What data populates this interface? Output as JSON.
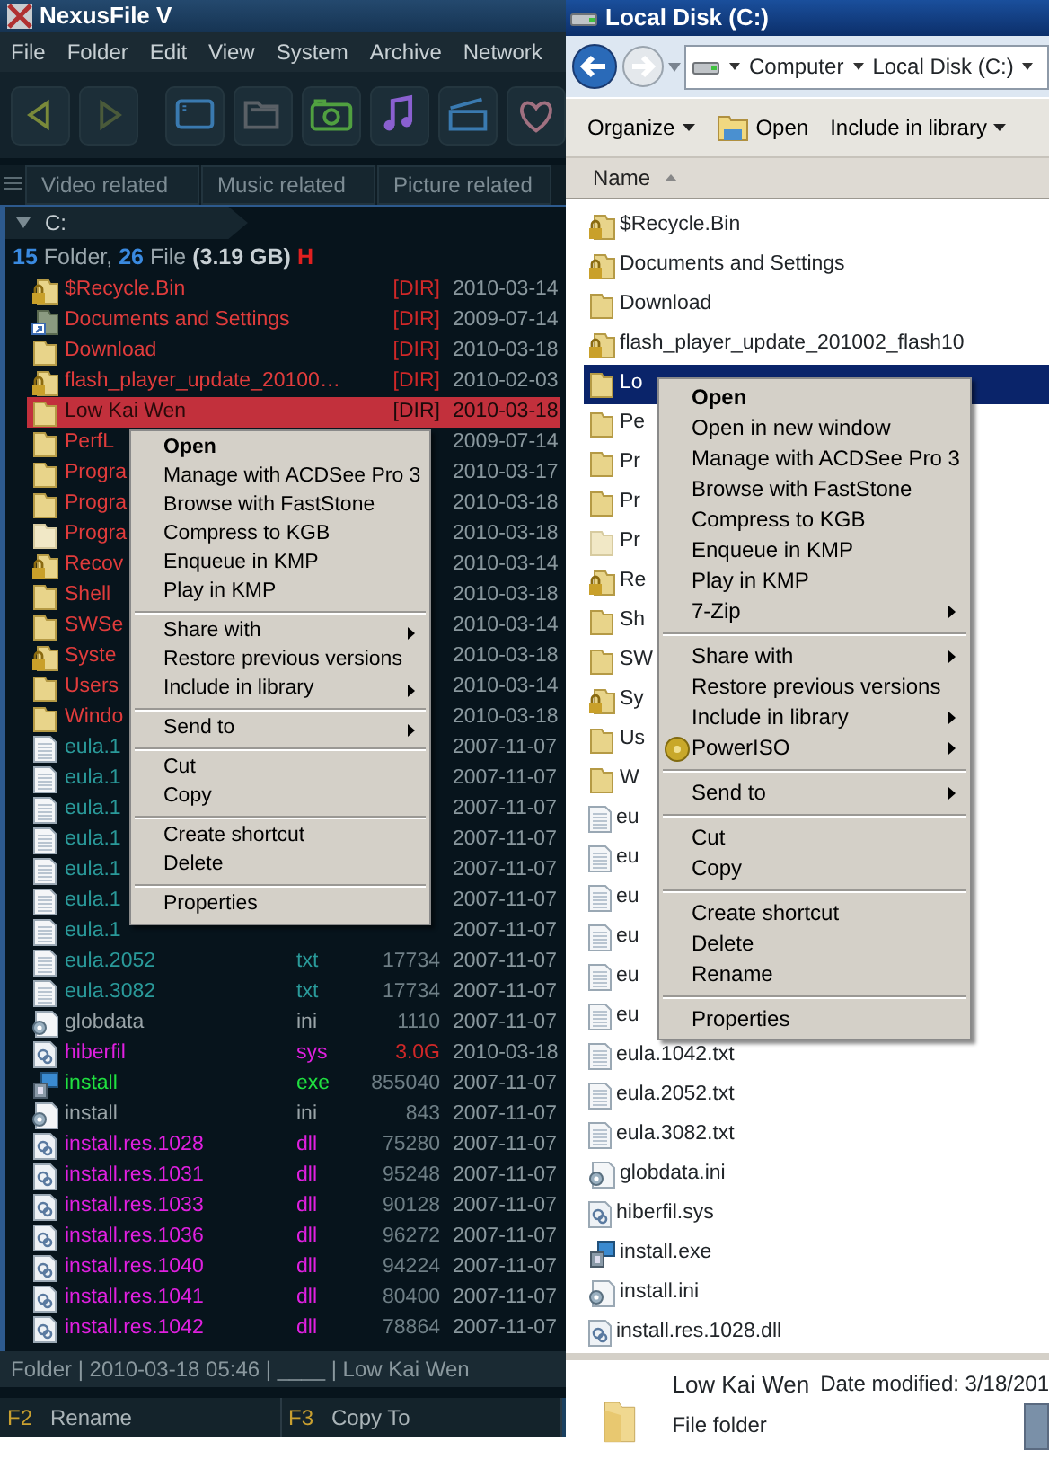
{
  "nexusfile": {
    "title": "NexusFile V",
    "menu": [
      "File",
      "Folder",
      "Edit",
      "View",
      "System",
      "Archive",
      "Network"
    ],
    "tabs": [
      "Video related",
      "Music related",
      "Picture related"
    ],
    "path": "C:",
    "summary": [
      {
        "text": "15",
        "kind": "count"
      },
      {
        "text": " Folder, ",
        "kind": "plain"
      },
      {
        "text": "26",
        "kind": "count"
      },
      {
        "text": " File ",
        "kind": "plain"
      },
      {
        "text": "(3.19 GB)",
        "kind": "size"
      },
      {
        "text": " H",
        "kind": "flag"
      }
    ],
    "rows": [
      {
        "kind": "locked-folder",
        "name": "$Recycle.Bin",
        "size": "[DIR]",
        "size_alert": true,
        "date": "2010-03-14",
        "color": "#e03c3c",
        "selected": false
      },
      {
        "kind": "shortcut-folder",
        "name": "Documents and Settings",
        "size": "[DIR]",
        "size_alert": true,
        "date": "2009-07-14",
        "color": "#e03c3c",
        "selected": false
      },
      {
        "kind": "folder",
        "name": "Download",
        "size": "[DIR]",
        "size_alert": true,
        "date": "2010-03-18",
        "color": "#e03c3c",
        "selected": false
      },
      {
        "kind": "locked-folder",
        "name": "flash_player_update_20100…",
        "size": "[DIR]",
        "size_alert": true,
        "date": "2010-02-03",
        "color": "#e03c3c",
        "selected": false
      },
      {
        "kind": "folder",
        "name": "Low Kai Wen",
        "size": "[DIR]",
        "size_alert": true,
        "date": "2010-03-18",
        "color": "#2a0a0a",
        "selected": true
      },
      {
        "kind": "folder",
        "name": "PerfL",
        "date": "2009-07-14",
        "color": "#e03c3c",
        "selected": false
      },
      {
        "kind": "folder",
        "name": "Progra",
        "date": "2010-03-17",
        "color": "#e03c3c",
        "selected": false
      },
      {
        "kind": "folder",
        "name": "Progra",
        "date": "2010-03-18",
        "color": "#e03c3c",
        "selected": false
      },
      {
        "kind": "dim-folder",
        "name": "Progra",
        "date": "2010-03-18",
        "color": "#e03c3c",
        "selected": false
      },
      {
        "kind": "locked-folder",
        "name": "Recov",
        "date": "2010-03-14",
        "color": "#e03c3c",
        "selected": false
      },
      {
        "kind": "folder",
        "name": "Shell",
        "date": "2010-03-18",
        "color": "#e03c3c",
        "selected": false
      },
      {
        "kind": "folder",
        "name": "SWSe",
        "date": "2010-03-14",
        "color": "#e03c3c",
        "selected": false
      },
      {
        "kind": "locked-folder",
        "name": "Syste",
        "date": "2010-03-18",
        "color": "#e03c3c",
        "selected": false
      },
      {
        "kind": "folder",
        "name": "Users",
        "date": "2010-03-14",
        "color": "#e03c3c",
        "selected": false
      },
      {
        "kind": "folder",
        "name": "Windo",
        "date": "2010-03-18",
        "color": "#e03c3c",
        "selected": false
      },
      {
        "kind": "text",
        "name": "eula.1",
        "date": "2007-11-07",
        "color": "#2a9a9a",
        "selected": false
      },
      {
        "kind": "text",
        "name": "eula.1",
        "date": "2007-11-07",
        "color": "#2a9a9a",
        "selected": false
      },
      {
        "kind": "text",
        "name": "eula.1",
        "date": "2007-11-07",
        "color": "#2a9a9a",
        "selected": false
      },
      {
        "kind": "text",
        "name": "eula.1",
        "date": "2007-11-07",
        "color": "#2a9a9a",
        "selected": false
      },
      {
        "kind": "text",
        "name": "eula.1",
        "date": "2007-11-07",
        "color": "#2a9a9a",
        "selected": false
      },
      {
        "kind": "text",
        "name": "eula.1",
        "date": "2007-11-07",
        "color": "#2a9a9a",
        "selected": false
      },
      {
        "kind": "text",
        "name": "eula.1",
        "date": "2007-11-07",
        "color": "#2a9a9a",
        "selected": false
      },
      {
        "kind": "text",
        "name": "eula.2052",
        "ext": "txt",
        "size": "17734",
        "date": "2007-11-07",
        "color": "#2a9a9a",
        "selected": false
      },
      {
        "kind": "text",
        "name": "eula.3082",
        "ext": "txt",
        "size": "17734",
        "date": "2007-11-07",
        "color": "#2a9a9a",
        "selected": false
      },
      {
        "kind": "settings",
        "name": "globdata",
        "ext": "ini",
        "size": "1110",
        "date": "2007-11-07",
        "color": "#9aa4a8",
        "selected": false
      },
      {
        "kind": "system",
        "name": "hiberfil",
        "ext": "sys",
        "size": "3.0G",
        "size_alert": true,
        "date": "2010-03-18",
        "color": "#e020e0",
        "selected": false
      },
      {
        "kind": "installer",
        "name": "install",
        "ext": "exe",
        "size": "855040",
        "date": "2007-11-07",
        "color": "#20e040",
        "selected": false
      },
      {
        "kind": "settings",
        "name": "install",
        "ext": "ini",
        "size": "843",
        "date": "2007-11-07",
        "color": "#9aa4a8",
        "selected": false
      },
      {
        "kind": "system",
        "name": "install.res.1028",
        "ext": "dll",
        "size": "75280",
        "date": "2007-11-07",
        "color": "#e020e0",
        "selected": false
      },
      {
        "kind": "system",
        "name": "install.res.1031",
        "ext": "dll",
        "size": "95248",
        "date": "2007-11-07",
        "color": "#e020e0",
        "selected": false
      },
      {
        "kind": "system",
        "name": "install.res.1033",
        "ext": "dll",
        "size": "90128",
        "date": "2007-11-07",
        "color": "#e020e0",
        "selected": false
      },
      {
        "kind": "system",
        "name": "install.res.1036",
        "ext": "dll",
        "size": "96272",
        "date": "2007-11-07",
        "color": "#e020e0",
        "selected": false
      },
      {
        "kind": "system",
        "name": "install.res.1040",
        "ext": "dll",
        "size": "94224",
        "date": "2007-11-07",
        "color": "#e020e0",
        "selected": false
      },
      {
        "kind": "system",
        "name": "install.res.1041",
        "ext": "dll",
        "size": "80400",
        "date": "2007-11-07",
        "color": "#e020e0",
        "selected": false
      },
      {
        "kind": "system",
        "name": "install.res.1042",
        "ext": "dll",
        "size": "78864",
        "date": "2007-11-07",
        "color": "#e020e0",
        "selected": false
      }
    ],
    "context_menu": [
      [
        {
          "label": "Open",
          "default": true
        },
        {
          "label": "Manage with ACDSee Pro 3"
        },
        {
          "label": "Browse with FastStone"
        },
        {
          "label": "Compress to KGB"
        },
        {
          "label": "Enqueue in KMP"
        },
        {
          "label": "Play in KMP"
        }
      ],
      [
        {
          "label": "Share with",
          "submenu": true
        },
        {
          "label": "Restore previous versions"
        },
        {
          "label": "Include in library",
          "submenu": true
        }
      ],
      [
        {
          "label": "Send to",
          "submenu": true
        }
      ],
      [
        {
          "label": "Cut"
        },
        {
          "label": "Copy"
        }
      ],
      [
        {
          "label": "Create shortcut"
        },
        {
          "label": "Delete"
        }
      ],
      [
        {
          "label": "Properties"
        }
      ]
    ],
    "status": "Folder | 2010-03-18 05:46 | ____ | Low Kai Wen",
    "function_keys": [
      {
        "key": "F2",
        "label": "Rename"
      },
      {
        "key": "F3",
        "label": "Copy To"
      }
    ]
  },
  "explorer": {
    "title": "Local Disk (C:)",
    "breadcrumb": [
      "Computer",
      "Local Disk (C:)"
    ],
    "commands": [
      {
        "label": "Organize",
        "kind": "menu"
      },
      {
        "label": "Open",
        "kind": "action"
      },
      {
        "label": "Include in library",
        "kind": "menu"
      }
    ],
    "column": "Name",
    "rows": [
      {
        "kind": "locked-folder",
        "name": "$Recycle.Bin",
        "selected": false
      },
      {
        "kind": "locked-folder",
        "name": "Documents and Settings",
        "selected": false
      },
      {
        "kind": "folder",
        "name": "Download",
        "selected": false
      },
      {
        "kind": "locked-folder",
        "name": "flash_player_update_201002_flash10",
        "selected": false
      },
      {
        "kind": "folder",
        "name": "Lo",
        "selected": true
      },
      {
        "kind": "folder",
        "name": "Pe",
        "selected": false
      },
      {
        "kind": "folder",
        "name": "Pr",
        "selected": false
      },
      {
        "kind": "folder",
        "name": "Pr",
        "selected": false
      },
      {
        "kind": "dim-folder",
        "name": "Pr",
        "selected": false
      },
      {
        "kind": "locked-folder",
        "name": "Re",
        "selected": false
      },
      {
        "kind": "folder",
        "name": "Sh",
        "selected": false
      },
      {
        "kind": "folder",
        "name": "SW",
        "selected": false
      },
      {
        "kind": "locked-folder",
        "name": "Sy",
        "selected": false
      },
      {
        "kind": "folder",
        "name": "Us",
        "selected": false
      },
      {
        "kind": "folder",
        "name": "W",
        "selected": false
      },
      {
        "kind": "text",
        "name": "eu",
        "selected": false
      },
      {
        "kind": "text",
        "name": "eu",
        "selected": false
      },
      {
        "kind": "text",
        "name": "eu",
        "selected": false
      },
      {
        "kind": "text",
        "name": "eu",
        "selected": false
      },
      {
        "kind": "text",
        "name": "eu",
        "selected": false
      },
      {
        "kind": "text",
        "name": "eu",
        "selected": false
      },
      {
        "kind": "text",
        "name": "eula.1042.txt",
        "selected": false
      },
      {
        "kind": "text",
        "name": "eula.2052.txt",
        "selected": false
      },
      {
        "kind": "text",
        "name": "eula.3082.txt",
        "selected": false
      },
      {
        "kind": "settings",
        "name": "globdata.ini",
        "selected": false
      },
      {
        "kind": "system",
        "name": "hiberfil.sys",
        "selected": false
      },
      {
        "kind": "installer",
        "name": "install.exe",
        "selected": false
      },
      {
        "kind": "settings",
        "name": "install.ini",
        "selected": false
      },
      {
        "kind": "system",
        "name": "install.res.1028.dll",
        "selected": false
      }
    ],
    "context_menu": [
      [
        {
          "label": "Open",
          "default": true
        },
        {
          "label": "Open in new window"
        },
        {
          "label": "Manage with ACDSee Pro 3"
        },
        {
          "label": "Browse with FastStone"
        },
        {
          "label": "Compress to KGB"
        },
        {
          "label": "Enqueue in KMP"
        },
        {
          "label": "Play in KMP"
        },
        {
          "label": "7-Zip",
          "submenu": true
        }
      ],
      [
        {
          "label": "Share with",
          "submenu": true
        },
        {
          "label": "Restore previous versions"
        },
        {
          "label": "Include in library",
          "submenu": true
        },
        {
          "label": "PowerISO",
          "submenu": true
        }
      ],
      [
        {
          "label": "Send to",
          "submenu": true
        }
      ],
      [
        {
          "label": "Cut"
        },
        {
          "label": "Copy"
        }
      ],
      [
        {
          "label": "Create shortcut"
        },
        {
          "label": "Delete"
        },
        {
          "label": "Rename"
        }
      ],
      [
        {
          "label": "Properties"
        }
      ]
    ],
    "details": {
      "name": "Low Kai Wen",
      "date_modified": "Date modified: 3/18/201",
      "type": "File folder"
    }
  }
}
